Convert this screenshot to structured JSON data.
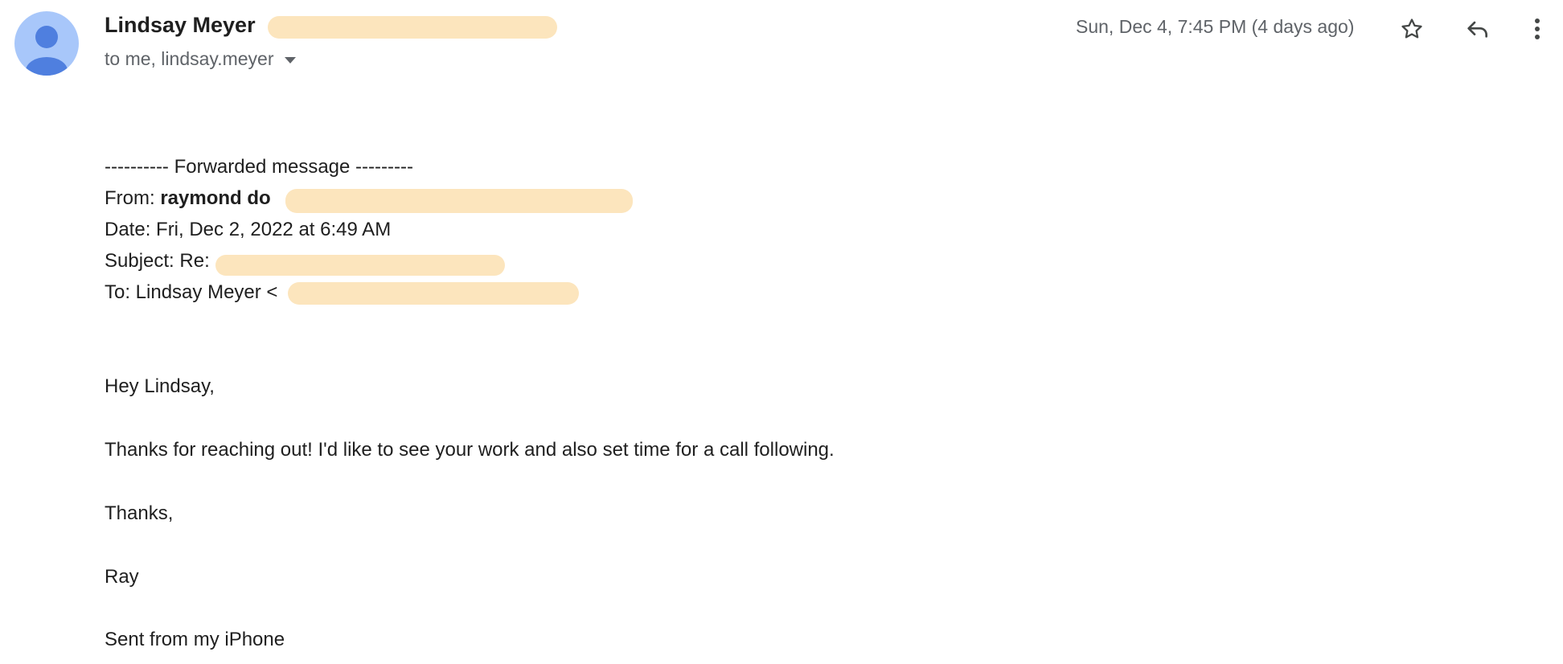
{
  "header": {
    "sender_name": "Lindsay Meyer",
    "recipients": "to me, lindsay.meyer",
    "date": "Sun, Dec 4, 7:45 PM (4 days ago)",
    "icons": {
      "avatar": "person-avatar-icon",
      "star": "star-icon",
      "reply": "reply-icon",
      "more": "more-vert-icon",
      "caret": "chevron-down-icon"
    }
  },
  "forward": {
    "separator": "---------- Forwarded message ---------",
    "from_label": "From:",
    "from_name": "raymond do",
    "date_line": "Date: Fri, Dec 2, 2022 at 6:49 AM",
    "subject_label": "Subject: Re:",
    "to_line": "To: Lindsay Meyer <"
  },
  "message": {
    "greeting": "Hey Lindsay,",
    "body": "Thanks for reaching out! I'd like to see your work and also set time for a call following.",
    "closing": "Thanks,",
    "signature": "Ray",
    "footer": "Sent from my iPhone"
  },
  "colors": {
    "avatar_bg": "#a8c7fa",
    "avatar_fg": "#4f7fdf",
    "redaction": "#fce5bd",
    "muted_text": "#5f6368"
  }
}
